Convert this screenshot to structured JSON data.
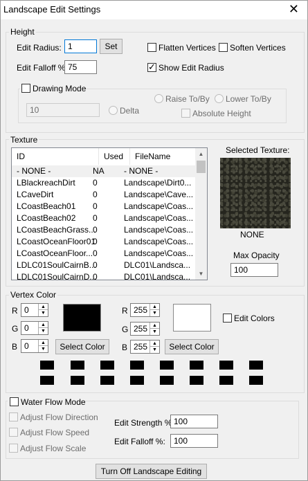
{
  "window": {
    "title": "Landscape Edit Settings",
    "close_glyph": "✕"
  },
  "height": {
    "group_label": "Height",
    "edit_radius_label": "Edit Radius:",
    "edit_radius_value": "1",
    "set_button": "Set",
    "edit_falloff_label": "Edit Falloff %:",
    "edit_falloff_value": "75",
    "flatten_vertices": {
      "label": "Flatten Vertices",
      "checked": false
    },
    "soften_vertices": {
      "label": "Soften Vertices",
      "checked": false
    },
    "show_edit_radius": {
      "label": "Show Edit Radius",
      "checked": true
    },
    "drawing_mode": {
      "label": "Drawing Mode",
      "checked": false
    },
    "drawing_value": "10",
    "delta_label": "Delta",
    "raise_to_by_label": "Raise To/By",
    "lower_to_by_label": "Lower To/By",
    "absolute_height_label": "Absolute Height"
  },
  "texture": {
    "group_label": "Texture",
    "columns": [
      "ID",
      "Used",
      "FileName"
    ],
    "rows": [
      {
        "id": "- NONE -",
        "used": "NA",
        "file": "- NONE -"
      },
      {
        "id": "LBlackreachDirt",
        "used": "0",
        "file": "Landscape\\Dirt0..."
      },
      {
        "id": "LCaveDirt",
        "used": "0",
        "file": "Landscape\\Cave..."
      },
      {
        "id": "LCoastBeach01",
        "used": "0",
        "file": "Landscape\\Coas..."
      },
      {
        "id": "LCoastBeach02",
        "used": "0",
        "file": "Landscape\\Coas..."
      },
      {
        "id": "LCoastBeachGrass...",
        "used": "0",
        "file": "Landscape\\Coas..."
      },
      {
        "id": "LCoastOceanFloor01",
        "used": "0",
        "file": "Landscape\\Coas..."
      },
      {
        "id": "LCoastOceanFloor...",
        "used": "0",
        "file": "Landscape\\Coas..."
      },
      {
        "id": "LDLC01SoulCairnB...",
        "used": "0",
        "file": "DLC01\\Landsca..."
      },
      {
        "id": "LDLC01SoulCairnD...",
        "used": "0",
        "file": "DLC01\\Landsca..."
      }
    ],
    "selected_texture_label": "Selected Texture:",
    "selected_texture_name": "NONE",
    "max_opacity_label": "Max Opacity",
    "max_opacity_value": "100"
  },
  "vertex_color": {
    "group_label": "Vertex Color",
    "left": {
      "r": "0",
      "g": "0",
      "b": "0",
      "swatch": "#000000"
    },
    "right": {
      "r": "255",
      "g": "255",
      "b": "255",
      "swatch": "#ffffff"
    },
    "r_label": "R",
    "g_label": "G",
    "b_label": "B",
    "select_color_button": "Select Color",
    "edit_colors": {
      "label": "Edit Colors",
      "checked": false
    },
    "palette_color": "#000000"
  },
  "water_flow": {
    "mode": {
      "label": "Water Flow Mode",
      "checked": false
    },
    "adjust_flow_direction": "Adjust Flow Direction",
    "adjust_flow_speed": "Adjust Flow Speed",
    "adjust_flow_scale": "Adjust Flow Scale",
    "edit_strength_label": "Edit Strength %:",
    "edit_strength_value": "100",
    "edit_falloff_label": "Edit Falloff %:",
    "edit_falloff_value": "100"
  },
  "footer": {
    "turn_off_button": "Turn Off Landscape Editing"
  }
}
